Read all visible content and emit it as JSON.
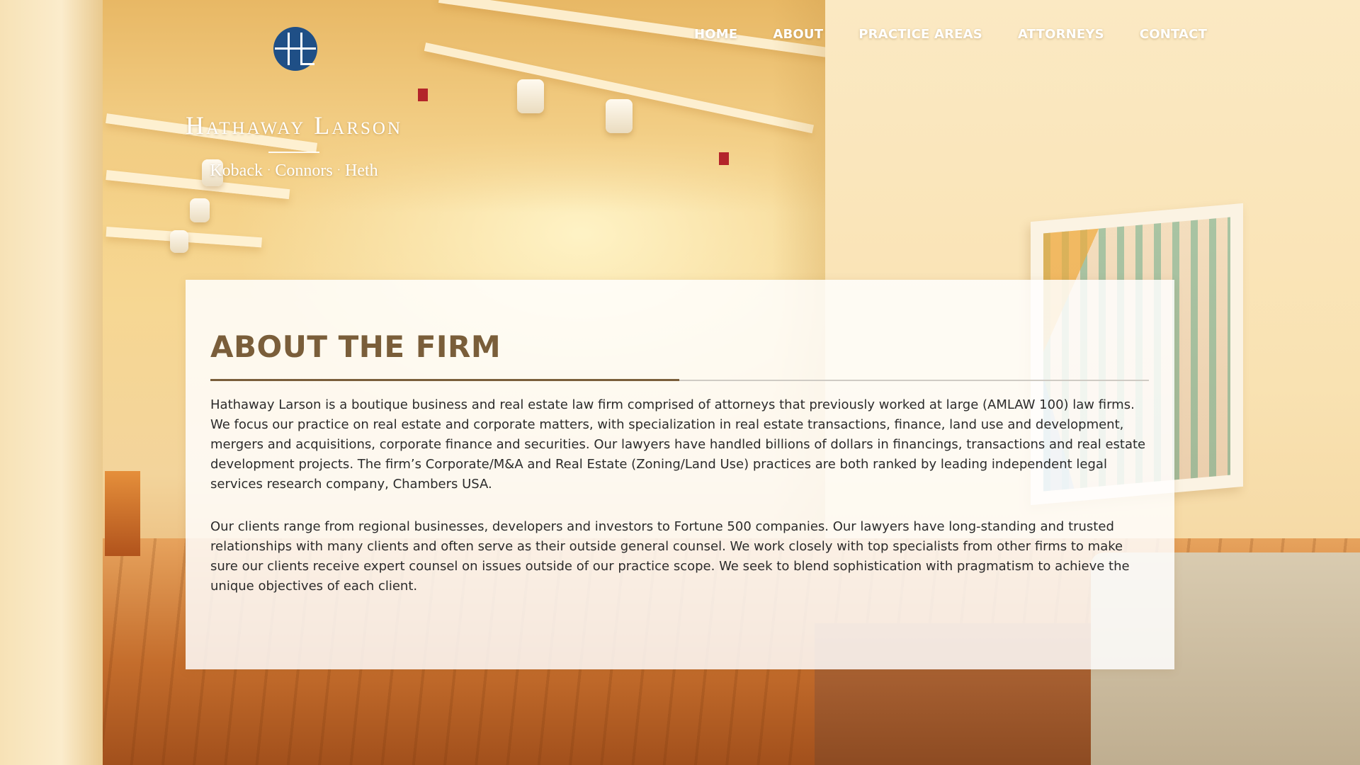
{
  "header": {
    "logo": {
      "monogram": "HL",
      "firm_name": "Hathaway Larson",
      "partners": [
        "Koback",
        "Connors",
        "Heth"
      ]
    },
    "nav": [
      {
        "label": "HOME"
      },
      {
        "label": "ABOUT"
      },
      {
        "label": "PRACTICE AREAS"
      },
      {
        "label": "ATTORNEYS"
      },
      {
        "label": "CONTACT"
      }
    ]
  },
  "about": {
    "title": "ABOUT THE FIRM",
    "paragraphs": [
      "Hathaway Larson is a boutique business and real estate law firm comprised of attorneys that previously worked at large (AMLAW 100) law firms. We focus our practice on real estate and corporate matters, with specialization in real estate transactions, finance, land use and development, mergers and acquisitions, corporate finance and securities. Our lawyers have handled billions of dollars in financings, transactions and real estate development projects. The firm’s Corporate/M&A and Real Estate (Zoning/Land Use) practices are both ranked by leading independent legal services research company, Chambers USA.",
      "Our clients range from regional businesses, developers and investors to Fortune 500 companies. Our lawyers have long-standing and trusted relationships with many clients and often serve as their outside general counsel. We work closely with top specialists from other firms to make sure our clients receive expert counsel on issues outside of our practice scope. We seek to blend sophistication with pragmatism to achieve the unique objectives of each client."
    ]
  },
  "colors": {
    "heading": "#7a5e3a",
    "body_text": "#2b2b2b",
    "logo_blue": "#1f4f86",
    "nav_text": "#ffffff"
  }
}
